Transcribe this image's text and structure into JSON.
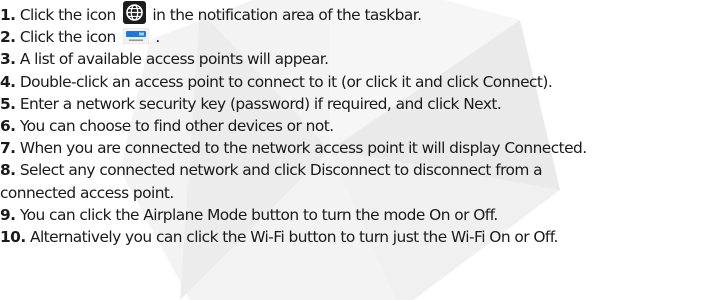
{
  "steps": [
    {
      "num": "1.",
      "before": "Click the icon",
      "icon": "globe-network-icon",
      "after": "in the notification area of the taskbar."
    },
    {
      "num": "2.",
      "before": "Click the icon",
      "icon": "wifi-tile-icon",
      "after": "."
    },
    {
      "num": "3.",
      "text": "A list of available access points will appear."
    },
    {
      "num": "4.",
      "text": "Double-click an access point to connect to it (or click it and click Connect)."
    },
    {
      "num": "5.",
      "text": "Enter a network security key (password) if required, and click Next."
    },
    {
      "num": "6.",
      "text": "You can choose to find other devices or not."
    },
    {
      "num": "7.",
      "text": "When you are connected to the network access point it will display Connected."
    },
    {
      "num": "8.",
      "text": "Select any connected network and click Disconnect to disconnect from a",
      "continuation": "connected access point."
    },
    {
      "num": "9.",
      "text": "You can click the Airplane Mode button to turn the mode On or Off."
    },
    {
      "num": "10.",
      "text": "Alternatively you can click the Wi-Fi button to turn just the Wi-Fi On or Off."
    }
  ],
  "colors": {
    "text": "#1a1a1a",
    "watermark": "#eeeeee",
    "tile_accent": "#1e78d7"
  }
}
